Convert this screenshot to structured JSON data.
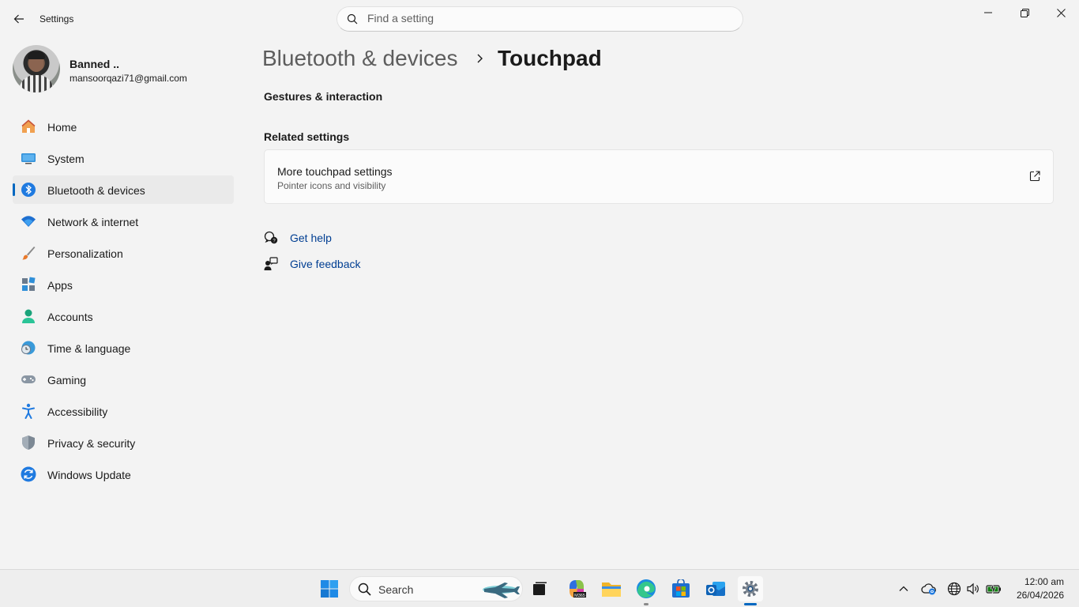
{
  "window": {
    "app_title": "Settings",
    "search_placeholder": "Find a setting"
  },
  "profile": {
    "name": "Banned ..",
    "email": "mansoorqazi71@gmail.com"
  },
  "sidebar": {
    "items": [
      {
        "label": "Home",
        "icon": "home-icon"
      },
      {
        "label": "System",
        "icon": "system-icon"
      },
      {
        "label": "Bluetooth & devices",
        "icon": "bluetooth-icon",
        "selected": true
      },
      {
        "label": "Network & internet",
        "icon": "wifi-icon"
      },
      {
        "label": "Personalization",
        "icon": "brush-icon"
      },
      {
        "label": "Apps",
        "icon": "apps-icon"
      },
      {
        "label": "Accounts",
        "icon": "accounts-icon"
      },
      {
        "label": "Time & language",
        "icon": "globe-clock-icon"
      },
      {
        "label": "Gaming",
        "icon": "gamepad-icon"
      },
      {
        "label": "Accessibility",
        "icon": "accessibility-icon"
      },
      {
        "label": "Privacy & security",
        "icon": "shield-icon"
      },
      {
        "label": "Windows Update",
        "icon": "update-icon"
      }
    ]
  },
  "main": {
    "breadcrumb_parent": "Bluetooth & devices",
    "breadcrumb_current": "Touchpad",
    "gestures_heading": "Gestures & interaction",
    "related_heading": "Related settings",
    "card": {
      "title": "More touchpad settings",
      "subtitle": "Pointer icons and visibility"
    },
    "get_help": "Get help",
    "give_feedback": "Give feedback"
  },
  "taskbar": {
    "search_label": "Search",
    "time": "12:00 am",
    "date": "26/04/2026"
  },
  "colors": {
    "accent": "#0067c0",
    "link": "#003e92",
    "background": "#f3f3f3"
  }
}
